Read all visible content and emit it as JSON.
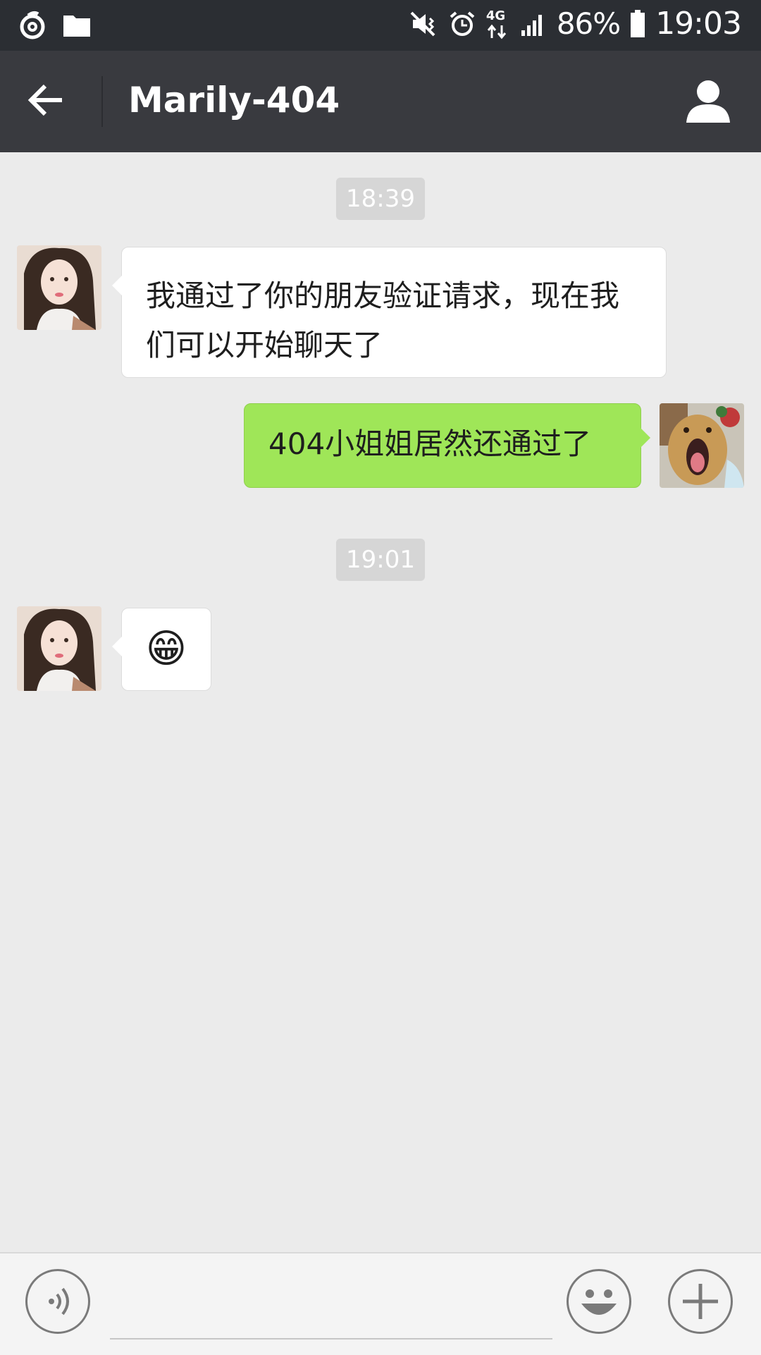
{
  "status_bar": {
    "icons_left": [
      "netease-music-icon",
      "folder-icon"
    ],
    "icons_right": [
      "vibrate-mute-icon",
      "alarm-icon",
      "4g-data-icon",
      "signal-icon",
      "battery-icon"
    ],
    "network": "4G",
    "battery": "86%",
    "time": "19:03"
  },
  "header": {
    "title": "Marily-404",
    "back_icon": "back-arrow-icon",
    "profile_icon": "person-icon",
    "background": "#393a3f"
  },
  "chat": {
    "timestamps": [
      "18:39",
      "19:01"
    ],
    "messages": [
      {
        "direction": "incoming",
        "text": "我通过了你的朋友验证请求，现在我们可以开始聊天了"
      },
      {
        "direction": "outgoing",
        "text": "404小姐姐居然还通过了"
      },
      {
        "direction": "incoming",
        "text": "😁"
      }
    ],
    "outgoing_bubble_color": "#9fe658",
    "incoming_bubble_color": "#ffffff"
  },
  "input_bar": {
    "voice_icon": "voice-icon",
    "emoji_icon": "emoji-icon",
    "plus_icon": "plus-icon",
    "message_value": ""
  }
}
